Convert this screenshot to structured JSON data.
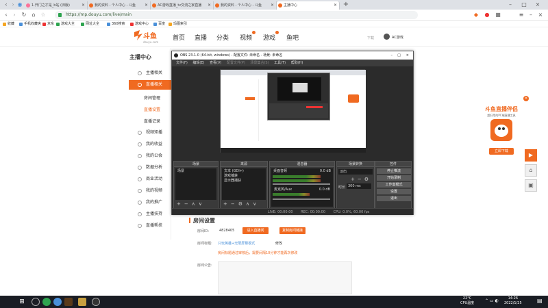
{
  "browser": {
    "tabs": [
      {
        "label": "1.开门之才是_b站 (旧版)"
      },
      {
        "label": "我的资料 - 个人中心 - 斗鱼"
      },
      {
        "label": "AC游戏直播_tv交流之家直播"
      },
      {
        "label": "我的资料 - 个人中心 - 斗鱼"
      },
      {
        "label": "主播中心"
      }
    ],
    "url": "https://mp.douyu.com/live/main",
    "bookmarks": [
      "收藏",
      "手机收藏夹",
      "京东",
      "游戏大全",
      "网址大全",
      "360搜索",
      "游戏中心",
      "百度",
      "玛图索引"
    ]
  },
  "site": {
    "logo_text": "斗鱼",
    "logo_sub": "douyu.com",
    "nav": [
      "首页",
      "直播",
      "分类",
      "视频",
      "游戏",
      "鱼吧"
    ],
    "download": "下载",
    "user": "AC游戏"
  },
  "sidebar": {
    "title": "主播中心",
    "items": [
      {
        "label": "主播相关"
      },
      {
        "label": "直播相关"
      },
      {
        "label": "房间管理"
      },
      {
        "label": "直播设置"
      },
      {
        "label": "直播记录"
      },
      {
        "label": "视频矩播"
      },
      {
        "label": "我的收益"
      },
      {
        "label": "我的公会"
      },
      {
        "label": "数据分析"
      },
      {
        "label": "商业活动"
      },
      {
        "label": "我的视频"
      },
      {
        "label": "我的推广"
      },
      {
        "label": "主播扶持"
      },
      {
        "label": "直播帮扶"
      }
    ]
  },
  "obs": {
    "title": "OBS 23.1.0 (64-bit, windows) - 配置文件: 未命名 - 场景: 未命名",
    "menu": [
      "文件(F)",
      "编辑(E)",
      "查看(V)",
      "配置文件(P)",
      "场景集合(S)",
      "工具(T)",
      "帮助(H)"
    ],
    "panels": {
      "scenes": {
        "title": "场景",
        "items": [
          "场景"
        ]
      },
      "sources": {
        "title": "来源",
        "items": [
          "文本 (GDI+)",
          "游戏捕获",
          "显示器捕获"
        ]
      },
      "mixer": {
        "title": "混音器",
        "tracks": [
          {
            "name": "桌面音频",
            "db": "0.0 dB"
          },
          {
            "name": "麦克风/Aux",
            "db": "0.0 dB"
          }
        ]
      },
      "transitions": {
        "title": "场景转换",
        "type": "淡出",
        "duration_label": "时长",
        "duration": "300 ms"
      },
      "controls": {
        "title": "控件",
        "buttons": [
          "停止推流",
          "开始录制",
          "工作室模式",
          "设置",
          "退出"
        ]
      }
    },
    "status": {
      "live": "LIVE: 00:00:00",
      "rec": "REC: 00:00:00",
      "cpu": "CPU: 0.0%, 60.00 fps"
    }
  },
  "room": {
    "title": "房间设置",
    "room_id_label": "房间ID:",
    "room_id": "4828405",
    "btn_enter": "进入直播间",
    "btn_copy": "复制房间链接",
    "title_label": "房间标题:",
    "title_value": "只玩英雄+无限屏幕模式",
    "modify": "修改",
    "hint": "房间标题通过审核后，需要间隔10分钟才能再次修改",
    "announce_label": "房间公告:"
  },
  "promo": {
    "title": "斗鱼直播伴侣",
    "subtitle": "超好用的PC端直播工具",
    "button": "立即下载"
  },
  "taskbar": {
    "temp": "22°C",
    "weather": "CPU温度",
    "time": "14:26",
    "date": "2022/1/25"
  },
  "colors": {
    "accent": "#f06a21",
    "obs_bg": "#2b2b2b"
  }
}
